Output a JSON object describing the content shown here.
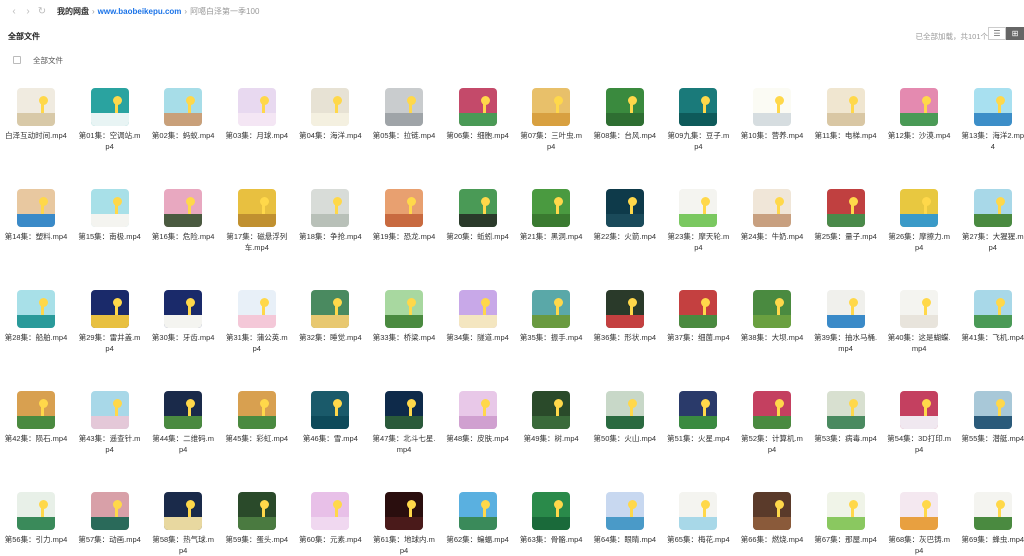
{
  "nav": {
    "back": "‹",
    "forward": "›",
    "refresh": "↻"
  },
  "breadcrumb": {
    "root": "我的网盘",
    "sep1": "›",
    "site": "www.baobeikepu.com",
    "sep2": "›",
    "current": "阿噶白泽第一季100"
  },
  "header": {
    "title": "全部文件",
    "count": "已全部加载，共101个"
  },
  "select_all": "全部文件",
  "view": {
    "list_icon": "list-icon",
    "grid_icon": "grid-icon"
  },
  "files": [
    {
      "name": "白泽互动时间.mp4",
      "sky": "#f0ebe0",
      "ground": "#d8c9a8",
      "dark": true
    },
    {
      "name": "第01集：空调站.mp4",
      "sky": "#2aa3a0",
      "ground": "#e8f4f4"
    },
    {
      "name": "第02集：蚂蚁.mp4",
      "sky": "#a7dde8",
      "ground": "#c9a07a"
    },
    {
      "name": "第03集：月球.mp4",
      "sky": "#e8d9f0",
      "ground": "#f4e6f4"
    },
    {
      "name": "第04集：海洋.mp4",
      "sky": "#e7e2d4",
      "ground": "#f4f0e0"
    },
    {
      "name": "第05集：拉链.mp4",
      "sky": "#c9ccce",
      "ground": "#9fa4a8"
    },
    {
      "name": "第06集：细胞.mp4",
      "sky": "#c44a6a",
      "ground": "#4a9a56"
    },
    {
      "name": "第07集：三叶虫.mp4",
      "sky": "#e8c06a",
      "ground": "#d8a040"
    },
    {
      "name": "第08集：台风.mp4",
      "sky": "#3a8a3e",
      "ground": "#2e6e32"
    },
    {
      "name": "第09九集：豆子.mp4",
      "sky": "#1a7a7a",
      "ground": "#0e5a5a"
    },
    {
      "name": "第10集：营养.mp4",
      "sky": "#fbfbf4",
      "ground": "#d6dde0"
    },
    {
      "name": "第11集：电梯.mp4",
      "sky": "#f0e6d0",
      "ground": "#d9c7a4"
    },
    {
      "name": "第12集：沙漠.mp4",
      "sky": "#e48ab0",
      "ground": "#4a9a56"
    },
    {
      "name": "第13集：海洋2.mp4",
      "sky": "#a8e0f0",
      "ground": "#3c8ec8"
    },
    {
      "name": "第14集：塑料.mp4",
      "sky": "#e8c8a0",
      "ground": "#3a8ac8"
    },
    {
      "name": "第15集：南极.mp4",
      "sky": "#a8e0e8",
      "ground": "#f4f4f0"
    },
    {
      "name": "第16集：危险.mp4",
      "sky": "#e8a8c0",
      "ground": "#4a5a40"
    },
    {
      "name": "第17集：磁悬浮列车.mp4",
      "sky": "#e8c040",
      "ground": "#c09030"
    },
    {
      "name": "第18集：争抢.mp4",
      "sky": "#d8dcd8",
      "ground": "#b8c0b8"
    },
    {
      "name": "第19集：恐龙.mp4",
      "sky": "#e8a070",
      "ground": "#c86a40"
    },
    {
      "name": "第20集：蚯蚓.mp4",
      "sky": "#4a9a56",
      "ground": "#2a3a2a"
    },
    {
      "name": "第21集：黑洞.mp4",
      "sky": "#4a9a40",
      "ground": "#3a7a30"
    },
    {
      "name": "第22集：火箭.mp4",
      "sky": "#0e3a4a",
      "ground": "#1a4a5a"
    },
    {
      "name": "第23集：摩天轮.mp4",
      "sky": "#f4f4f0",
      "ground": "#7ac860"
    },
    {
      "name": "第24集：牛奶.mp4",
      "sky": "#f0e6d8",
      "ground": "#c8a080"
    },
    {
      "name": "第25集：量子.mp4",
      "sky": "#c04040",
      "ground": "#4a8a4a"
    },
    {
      "name": "第26集：摩擦力.mp4",
      "sky": "#e8c840",
      "ground": "#3a9ac8"
    },
    {
      "name": "第27集：大猩猩.mp4",
      "sky": "#a8d8e8",
      "ground": "#4a8a40"
    },
    {
      "name": "第28集：船舶.mp4",
      "sky": "#a8e0e8",
      "ground": "#2a9a9a"
    },
    {
      "name": "第29集：雷井盖.mp4",
      "sky": "#1a2a6a",
      "ground": "#e8c040"
    },
    {
      "name": "第30集：牙齿.mp4",
      "sky": "#1a2a6a",
      "ground": "#f4f4f0"
    },
    {
      "name": "第31集：蒲公英.mp4",
      "sky": "#e8f0f8",
      "ground": "#f4c8d8"
    },
    {
      "name": "第32集：睡觉.mp4",
      "sky": "#4a8a60",
      "ground": "#e8c870"
    },
    {
      "name": "第33集：桥梁.mp4",
      "sky": "#a8d8a0",
      "ground": "#4a8a40"
    },
    {
      "name": "第34集：隧道.mp4",
      "sky": "#c8a8e8",
      "ground": "#f4e6c0"
    },
    {
      "name": "第35集：振手.mp4",
      "sky": "#5aa8a8",
      "ground": "#6a9a40"
    },
    {
      "name": "第36集：形状.mp4",
      "sky": "#2a3a2a",
      "ground": "#c44040"
    },
    {
      "name": "第37集：细菌.mp4",
      "sky": "#c44040",
      "ground": "#4a8a40"
    },
    {
      "name": "第38集：大坝.mp4",
      "sky": "#4a8a40",
      "ground": "#6aa040"
    },
    {
      "name": "第39集：抽水马桶.mp4",
      "sky": "#f0f0ec",
      "ground": "#3a8ac8"
    },
    {
      "name": "第40集：这是蝴蝶.mp4",
      "sky": "#f4f4f0",
      "ground": "#e8e4dc"
    },
    {
      "name": "第41集：飞机.mp4",
      "sky": "#a8d8e8",
      "ground": "#4a9a56"
    },
    {
      "name": "第42集：陨石.mp4",
      "sky": "#d8a050",
      "ground": "#4a8a40"
    },
    {
      "name": "第43集：遥查针.mp4",
      "sky": "#a8d8e8",
      "ground": "#e4c8d8"
    },
    {
      "name": "第44集：二维码.mp4",
      "sky": "#1a2a4a",
      "ground": "#4a8a40"
    },
    {
      "name": "第45集：彩虹.mp4",
      "sky": "#d8a050",
      "ground": "#4a8a40"
    },
    {
      "name": "第46集：雪.mp4",
      "sky": "#1a5a6a",
      "ground": "#0e4a5a"
    },
    {
      "name": "第47集：北斗七星.mp4",
      "sky": "#0e2a4a",
      "ground": "#2a5a3a"
    },
    {
      "name": "第48集：皮肤.mp4",
      "sky": "#e8c8e8",
      "ground": "#d0a0d0"
    },
    {
      "name": "第49集：树.mp4",
      "sky": "#2a4a2a",
      "ground": "#3a6a3a"
    },
    {
      "name": "第50集：火山.mp4",
      "sky": "#c8d8c8",
      "ground": "#2a6a40"
    },
    {
      "name": "第51集：火星.mp4",
      "sky": "#2a3a6a",
      "ground": "#3a8a40"
    },
    {
      "name": "第52集：计算机.mp4",
      "sky": "#c44060",
      "ground": "#4a8a40"
    },
    {
      "name": "第53集：病毒.mp4",
      "sky": "#d8e0d0",
      "ground": "#4a8a60"
    },
    {
      "name": "第54集：3D打印.mp4",
      "sky": "#c44060",
      "ground": "#f0e8f0"
    },
    {
      "name": "第55集：潜艇.mp4",
      "sky": "#a8c8d8",
      "ground": "#2a5a7a"
    },
    {
      "name": "第56集：引力.mp4",
      "sky": "#e8f0e8",
      "ground": "#3a8a5a"
    },
    {
      "name": "第57集：动画.mp4",
      "sky": "#d8a0a8",
      "ground": "#2a6a5a"
    },
    {
      "name": "第58集：热气球.mp4",
      "sky": "#1a2a4a",
      "ground": "#e8d8a0"
    },
    {
      "name": "第59集：蛋头.mp4",
      "sky": "#2a4a2a",
      "ground": "#4a7a40"
    },
    {
      "name": "第60集：元素.mp4",
      "sky": "#e8c0e8",
      "ground": "#f0d8f0"
    },
    {
      "name": "第61集：地球内.mp4",
      "sky": "#2a0e0e",
      "ground": "#4a1a1a"
    },
    {
      "name": "第62集：蝙蝠.mp4",
      "sky": "#5ab0e0",
      "ground": "#3a8a5a"
    },
    {
      "name": "第63集：骨骼.mp4",
      "sky": "#2a8a4a",
      "ground": "#1a6a3a"
    },
    {
      "name": "第64集：眼睛.mp4",
      "sky": "#c8d8f0",
      "ground": "#4a9ac8"
    },
    {
      "name": "第65集：梅花.mp4",
      "sky": "#f4f4f0",
      "ground": "#a8d8e8"
    },
    {
      "name": "第66集：燃烧.mp4",
      "sky": "#5a3a2a",
      "ground": "#8a5a3a"
    },
    {
      "name": "第67集：那屋.mp4",
      "sky": "#f0f4e8",
      "ground": "#8ac860"
    },
    {
      "name": "第68集：灰巴铸.mp4",
      "sky": "#f4e8f0",
      "ground": "#e8a040"
    },
    {
      "name": "第69集：蜂虫.mp4",
      "sky": "#f4f4f0",
      "ground": "#4a8a40"
    }
  ]
}
